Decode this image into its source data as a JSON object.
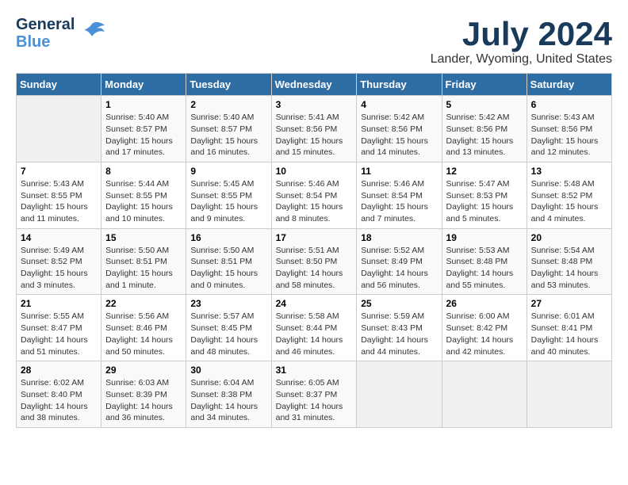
{
  "header": {
    "logo_line1": "General",
    "logo_line2": "Blue",
    "month_title": "July 2024",
    "location": "Lander, Wyoming, United States"
  },
  "days_of_week": [
    "Sunday",
    "Monday",
    "Tuesday",
    "Wednesday",
    "Thursday",
    "Friday",
    "Saturday"
  ],
  "weeks": [
    [
      {
        "day": "",
        "info": ""
      },
      {
        "day": "1",
        "info": "Sunrise: 5:40 AM\nSunset: 8:57 PM\nDaylight: 15 hours\nand 17 minutes."
      },
      {
        "day": "2",
        "info": "Sunrise: 5:40 AM\nSunset: 8:57 PM\nDaylight: 15 hours\nand 16 minutes."
      },
      {
        "day": "3",
        "info": "Sunrise: 5:41 AM\nSunset: 8:56 PM\nDaylight: 15 hours\nand 15 minutes."
      },
      {
        "day": "4",
        "info": "Sunrise: 5:42 AM\nSunset: 8:56 PM\nDaylight: 15 hours\nand 14 minutes."
      },
      {
        "day": "5",
        "info": "Sunrise: 5:42 AM\nSunset: 8:56 PM\nDaylight: 15 hours\nand 13 minutes."
      },
      {
        "day": "6",
        "info": "Sunrise: 5:43 AM\nSunset: 8:56 PM\nDaylight: 15 hours\nand 12 minutes."
      }
    ],
    [
      {
        "day": "7",
        "info": "Sunrise: 5:43 AM\nSunset: 8:55 PM\nDaylight: 15 hours\nand 11 minutes."
      },
      {
        "day": "8",
        "info": "Sunrise: 5:44 AM\nSunset: 8:55 PM\nDaylight: 15 hours\nand 10 minutes."
      },
      {
        "day": "9",
        "info": "Sunrise: 5:45 AM\nSunset: 8:55 PM\nDaylight: 15 hours\nand 9 minutes."
      },
      {
        "day": "10",
        "info": "Sunrise: 5:46 AM\nSunset: 8:54 PM\nDaylight: 15 hours\nand 8 minutes."
      },
      {
        "day": "11",
        "info": "Sunrise: 5:46 AM\nSunset: 8:54 PM\nDaylight: 15 hours\nand 7 minutes."
      },
      {
        "day": "12",
        "info": "Sunrise: 5:47 AM\nSunset: 8:53 PM\nDaylight: 15 hours\nand 5 minutes."
      },
      {
        "day": "13",
        "info": "Sunrise: 5:48 AM\nSunset: 8:52 PM\nDaylight: 15 hours\nand 4 minutes."
      }
    ],
    [
      {
        "day": "14",
        "info": "Sunrise: 5:49 AM\nSunset: 8:52 PM\nDaylight: 15 hours\nand 3 minutes."
      },
      {
        "day": "15",
        "info": "Sunrise: 5:50 AM\nSunset: 8:51 PM\nDaylight: 15 hours\nand 1 minute."
      },
      {
        "day": "16",
        "info": "Sunrise: 5:50 AM\nSunset: 8:51 PM\nDaylight: 15 hours\nand 0 minutes."
      },
      {
        "day": "17",
        "info": "Sunrise: 5:51 AM\nSunset: 8:50 PM\nDaylight: 14 hours\nand 58 minutes."
      },
      {
        "day": "18",
        "info": "Sunrise: 5:52 AM\nSunset: 8:49 PM\nDaylight: 14 hours\nand 56 minutes."
      },
      {
        "day": "19",
        "info": "Sunrise: 5:53 AM\nSunset: 8:48 PM\nDaylight: 14 hours\nand 55 minutes."
      },
      {
        "day": "20",
        "info": "Sunrise: 5:54 AM\nSunset: 8:48 PM\nDaylight: 14 hours\nand 53 minutes."
      }
    ],
    [
      {
        "day": "21",
        "info": "Sunrise: 5:55 AM\nSunset: 8:47 PM\nDaylight: 14 hours\nand 51 minutes."
      },
      {
        "day": "22",
        "info": "Sunrise: 5:56 AM\nSunset: 8:46 PM\nDaylight: 14 hours\nand 50 minutes."
      },
      {
        "day": "23",
        "info": "Sunrise: 5:57 AM\nSunset: 8:45 PM\nDaylight: 14 hours\nand 48 minutes."
      },
      {
        "day": "24",
        "info": "Sunrise: 5:58 AM\nSunset: 8:44 PM\nDaylight: 14 hours\nand 46 minutes."
      },
      {
        "day": "25",
        "info": "Sunrise: 5:59 AM\nSunset: 8:43 PM\nDaylight: 14 hours\nand 44 minutes."
      },
      {
        "day": "26",
        "info": "Sunrise: 6:00 AM\nSunset: 8:42 PM\nDaylight: 14 hours\nand 42 minutes."
      },
      {
        "day": "27",
        "info": "Sunrise: 6:01 AM\nSunset: 8:41 PM\nDaylight: 14 hours\nand 40 minutes."
      }
    ],
    [
      {
        "day": "28",
        "info": "Sunrise: 6:02 AM\nSunset: 8:40 PM\nDaylight: 14 hours\nand 38 minutes."
      },
      {
        "day": "29",
        "info": "Sunrise: 6:03 AM\nSunset: 8:39 PM\nDaylight: 14 hours\nand 36 minutes."
      },
      {
        "day": "30",
        "info": "Sunrise: 6:04 AM\nSunset: 8:38 PM\nDaylight: 14 hours\nand 34 minutes."
      },
      {
        "day": "31",
        "info": "Sunrise: 6:05 AM\nSunset: 8:37 PM\nDaylight: 14 hours\nand 31 minutes."
      },
      {
        "day": "",
        "info": ""
      },
      {
        "day": "",
        "info": ""
      },
      {
        "day": "",
        "info": ""
      }
    ]
  ]
}
